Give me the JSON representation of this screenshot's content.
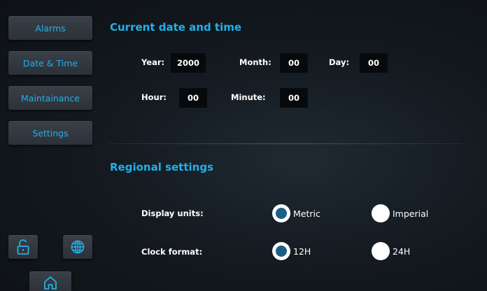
{
  "sidebar": {
    "items": [
      {
        "label": "Alarms"
      },
      {
        "label": "Date & Time"
      },
      {
        "label": "Maintainance"
      },
      {
        "label": "Settings"
      }
    ],
    "icons": [
      "unlock-icon",
      "globe-icon",
      "home-icon"
    ]
  },
  "datetime": {
    "title": "Current date and time",
    "year_label": "Year:",
    "year_value": "2000",
    "month_label": "Month:",
    "month_value": "00",
    "day_label": "Day:",
    "day_value": "00",
    "hour_label": "Hour:",
    "hour_value": "00",
    "minute_label": "Minute:",
    "minute_value": "00"
  },
  "regional": {
    "title": "Regional settings",
    "units_label": "Display units:",
    "units_options": [
      {
        "label": "Metric",
        "selected": true
      },
      {
        "label": "Imperial",
        "selected": false
      }
    ],
    "clock_label": "Clock format:",
    "clock_options": [
      {
        "label": "12H",
        "selected": true
      },
      {
        "label": "24H",
        "selected": false
      }
    ]
  },
  "colors": {
    "accent": "#22b0e8",
    "radio_selected": "#1c5f86",
    "button_bg": "#343a41",
    "field_bg": "#070a0d"
  }
}
